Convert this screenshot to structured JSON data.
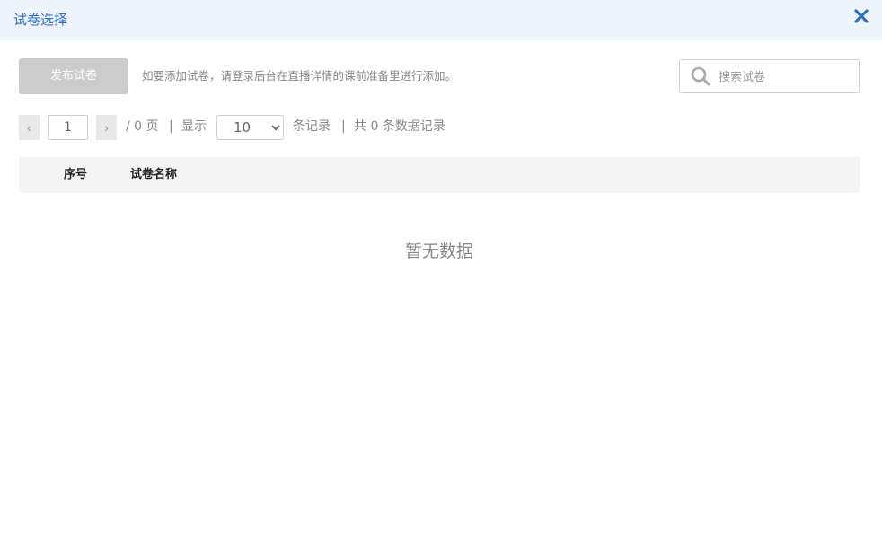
{
  "dialog": {
    "title": "试卷选择",
    "close_icon": "close-icon",
    "accent_color": "#2d6fc4"
  },
  "toolbar": {
    "publish_label": "发布试卷",
    "hint": "如要添加试卷，请登录后台在直播详情的课前准备里进行添加。",
    "search_placeholder": "搜索试卷",
    "search_icon": "search-icon"
  },
  "pager": {
    "prev_symbol": "‹",
    "next_symbol": "›",
    "current_page": "1",
    "total_pages_text": "/ 0 页",
    "sep1": "|",
    "show_label": "显示",
    "page_size": "10",
    "page_size_options": [
      "10"
    ],
    "records_label": "条记录",
    "sep2": "|",
    "total_records_text": "共 0 条数据记录"
  },
  "table": {
    "columns": [
      "序号",
      "试卷名称"
    ],
    "empty_text": "暂无数据"
  }
}
